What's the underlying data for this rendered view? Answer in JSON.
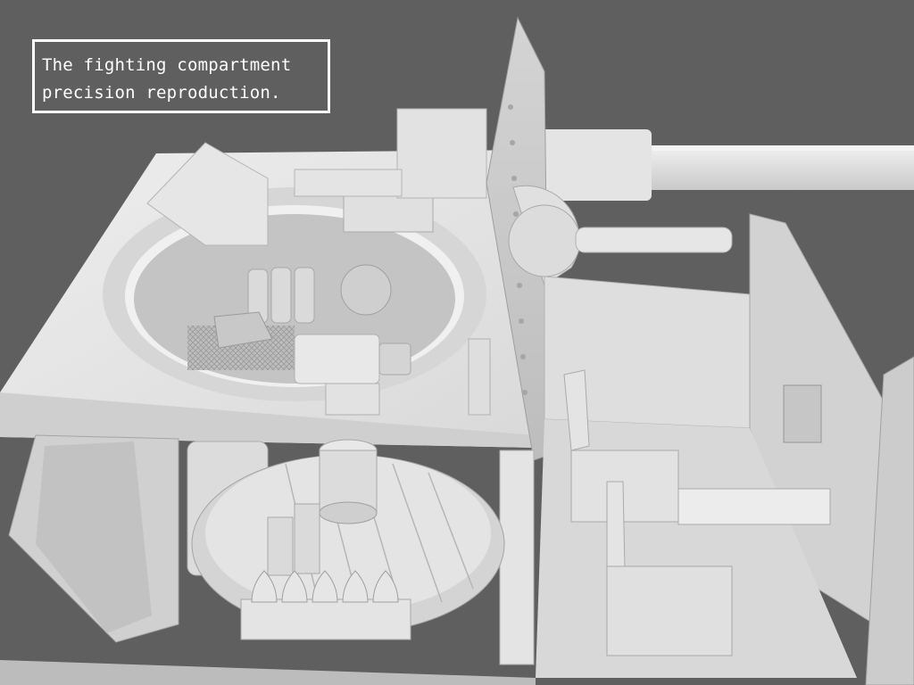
{
  "caption": {
    "line1": "The fighting compartment",
    "line2": "precision reproduction."
  },
  "colors": {
    "background": "#5f5f5f",
    "model": "#e6e6e6",
    "caption_text": "#ffffff"
  }
}
